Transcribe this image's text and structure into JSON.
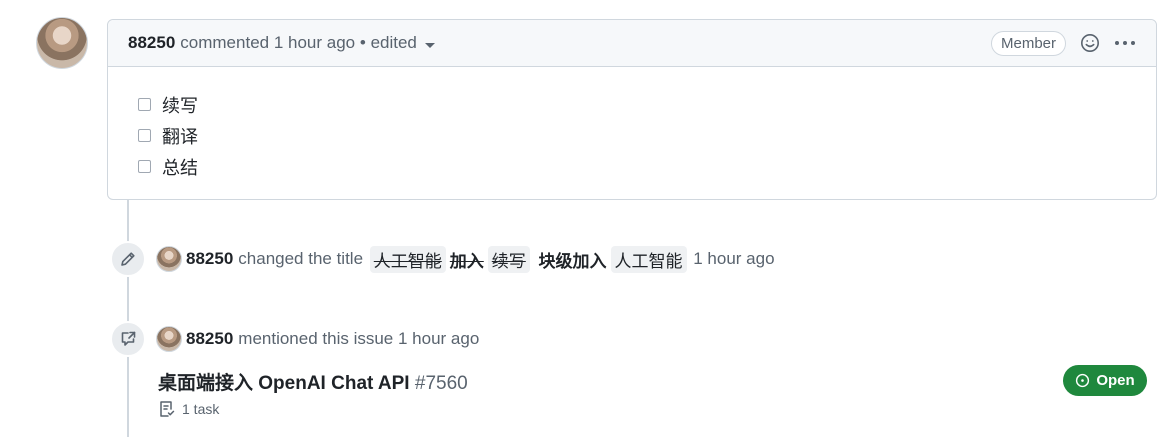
{
  "comment": {
    "author": "88250",
    "action": "commented",
    "time": "1 hour ago",
    "separator": "•",
    "edited": "edited",
    "role_badge": "Member",
    "tasks": [
      "续写",
      "翻译",
      "总结"
    ]
  },
  "title_change": {
    "actor": "88250",
    "action": "changed the title",
    "old_parts": [
      "人工智能",
      "加入",
      "续写"
    ],
    "new_parts": [
      "块级加入",
      "人工智能"
    ],
    "time": "1 hour ago"
  },
  "mention": {
    "actor": "88250",
    "action": "mentioned this issue",
    "time": "1 hour ago",
    "ref_title": "桌面端接入 OpenAI Chat API",
    "ref_number": "#7560",
    "task_count": "1 task",
    "status": "Open",
    "status_color": "#1f883d"
  },
  "icons": [
    "smiley-icon",
    "kebab-menu-icon",
    "pencil-icon",
    "cross-reference-icon",
    "checklist-icon",
    "issue-open-icon"
  ]
}
